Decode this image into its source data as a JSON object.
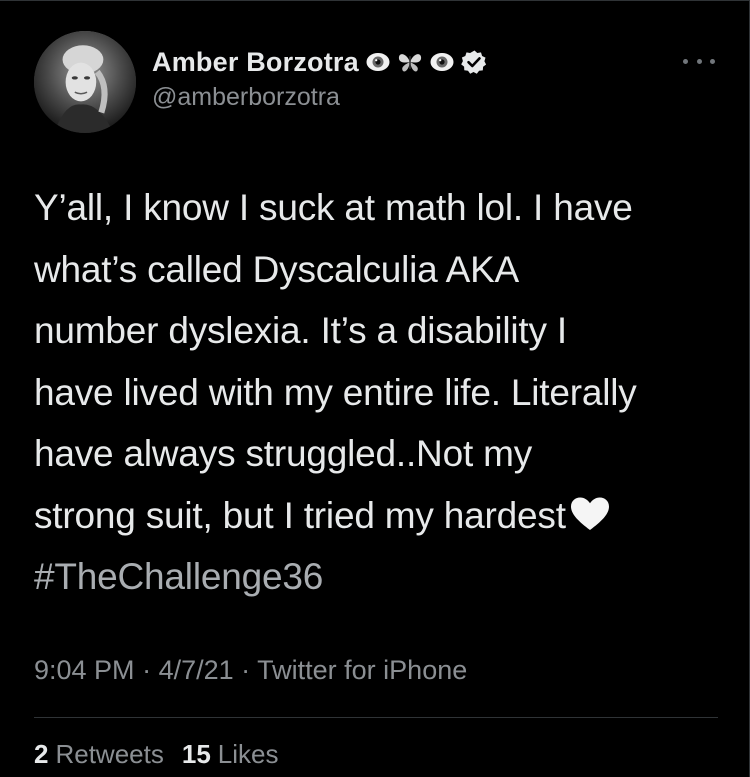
{
  "user": {
    "display_name": "Amber Borzotra",
    "handle": "@amberborzotra",
    "name_emojis": [
      "eye-icon",
      "butterfly-icon",
      "eye-icon"
    ],
    "verified": true
  },
  "tweet": {
    "lines": [
      "Y’all, I know I suck at math lol. I have",
      "what’s called Dyscalculia AKA",
      "number dyslexia. It’s a disability I",
      "have lived with my entire life. Literally",
      "have always struggled..Not my",
      "strong suit, but I tried my hardest"
    ],
    "emoji": "white-heart-icon",
    "hashtag": "#TheChallenge36"
  },
  "meta": {
    "time": "9:04 PM",
    "sep1": " · ",
    "date": "4/7/21",
    "sep2": " · ",
    "source": "Twitter for iPhone"
  },
  "stats": {
    "retweets_count": "2",
    "retweets_label": "Retweets",
    "likes_count": "15",
    "likes_label": "Likes"
  },
  "colors": {
    "background": "#000000",
    "text": "#e7e9ea",
    "secondary_text": "#8b8f93",
    "divider": "#2f3336"
  }
}
